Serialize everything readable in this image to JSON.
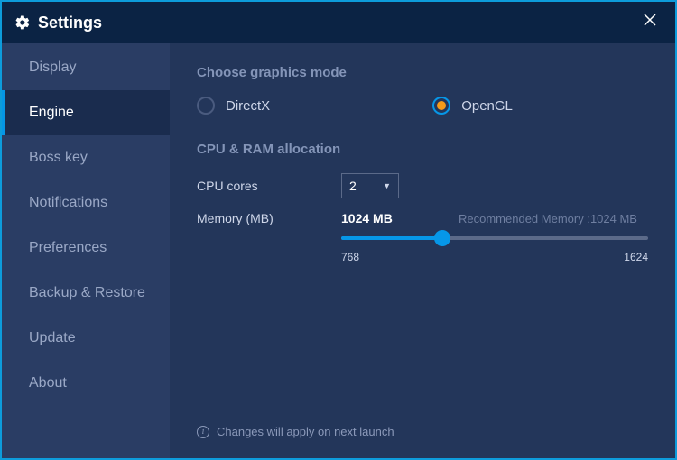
{
  "title": "Settings",
  "sidebar": {
    "items": [
      {
        "label": "Display"
      },
      {
        "label": "Engine"
      },
      {
        "label": "Boss key"
      },
      {
        "label": "Notifications"
      },
      {
        "label": "Preferences"
      },
      {
        "label": "Backup & Restore"
      },
      {
        "label": "Update"
      },
      {
        "label": "About"
      }
    ],
    "active_index": 1
  },
  "graphics": {
    "heading": "Choose graphics mode",
    "options": {
      "directx": "DirectX",
      "opengl": "OpenGL"
    },
    "selected": "opengl"
  },
  "allocation": {
    "heading": "CPU & RAM allocation",
    "cpu_label": "CPU cores",
    "cpu_value": "2",
    "memory_label": "Memory (MB)",
    "memory_value": "1024 MB",
    "memory_reco": "Recommended Memory :1024 MB",
    "slider_min": "768",
    "slider_max": "1624"
  },
  "footer": {
    "note": "Changes will apply on next launch"
  }
}
